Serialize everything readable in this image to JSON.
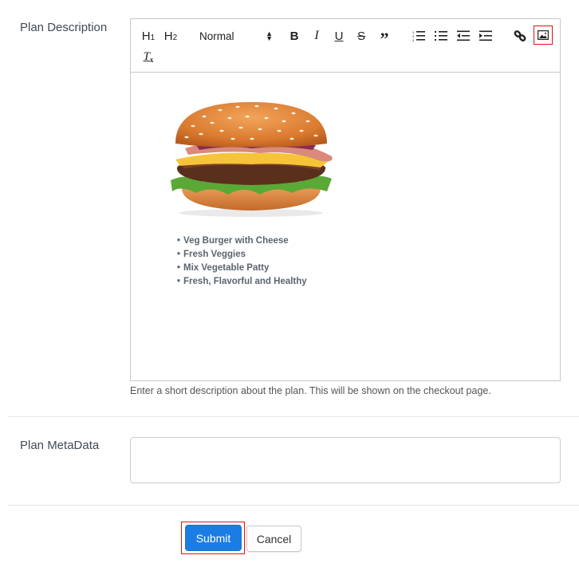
{
  "form": {
    "plan_description": {
      "label": "Plan Description",
      "help_text": "Enter a short description about the plan. This will be shown on the checkout page.",
      "toolbar": {
        "h1": "H1",
        "h2": "H2",
        "format_select": "Normal",
        "buttons": [
          "bold",
          "italic",
          "underline",
          "strike",
          "blockquote",
          "ordered-list",
          "bullet-list",
          "outdent",
          "indent",
          "link",
          "image",
          "clean-format"
        ]
      },
      "content": {
        "image_alt": "Burger image",
        "bullets": [
          "Veg Burger with Cheese",
          "Fresh Veggies",
          "Mix Vegetable Patty",
          "Fresh, Flavorful and Healthy"
        ]
      }
    },
    "plan_metadata": {
      "label": "Plan MetaData",
      "value": "",
      "placeholder": ""
    },
    "actions": {
      "submit_label": "Submit",
      "cancel_label": "Cancel"
    }
  },
  "colors": {
    "primary": "#1b7ce3",
    "highlight": "#e01010"
  }
}
